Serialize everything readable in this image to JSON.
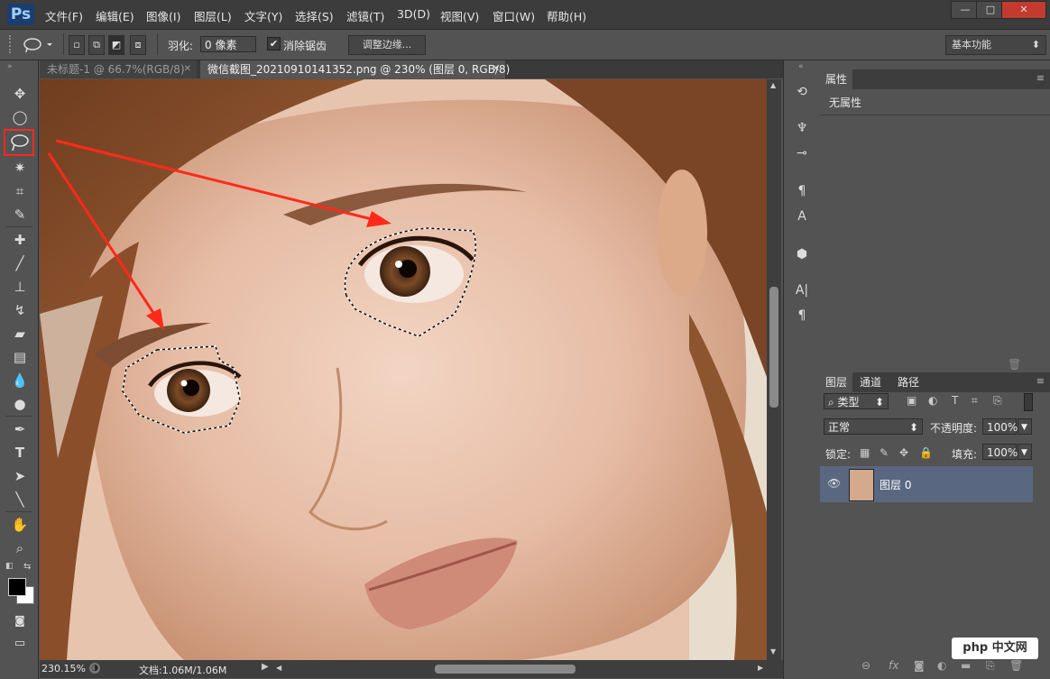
{
  "app": {
    "logo": "Ps"
  },
  "menu": [
    "文件(F)",
    "编辑(E)",
    "图像(I)",
    "图层(L)",
    "文字(Y)",
    "选择(S)",
    "滤镜(T)",
    "3D(D)",
    "视图(V)",
    "窗口(W)",
    "帮助(H)"
  ],
  "window_controls": {
    "minimize": "—",
    "maximize": "□",
    "close": "✕"
  },
  "options": {
    "feather_label": "羽化:",
    "feather_value": "0 像素",
    "antialias_label": "消除锯齿",
    "refine_edge": "调整边缘...",
    "workspace": "基本功能"
  },
  "tabs": [
    {
      "label": "未标题-1 @ 66.7%(RGB/8)",
      "close": "✕"
    },
    {
      "label": "微信截图_20210910141352.png @ 230% (图层 0, RGB/8)",
      "close": "✕"
    }
  ],
  "status": {
    "zoom": "230.15%",
    "doc": "文档:1.06M/1.06M"
  },
  "properties_panel": {
    "tab": "属性",
    "content": "无属性"
  },
  "layers_panel": {
    "tabs": [
      "图层",
      "通道",
      "路径"
    ],
    "filter": "类型",
    "blend_mode": "正常",
    "opacity_label": "不透明度:",
    "opacity_value": "100%",
    "lock_label": "锁定:",
    "fill_label": "填充:",
    "fill_value": "100%",
    "layers": [
      {
        "name": "图层 0"
      }
    ]
  },
  "watermark": "php 中文网",
  "colors": {
    "accent_red": "#ff2a1a",
    "selected_layer": "#5a6780"
  }
}
